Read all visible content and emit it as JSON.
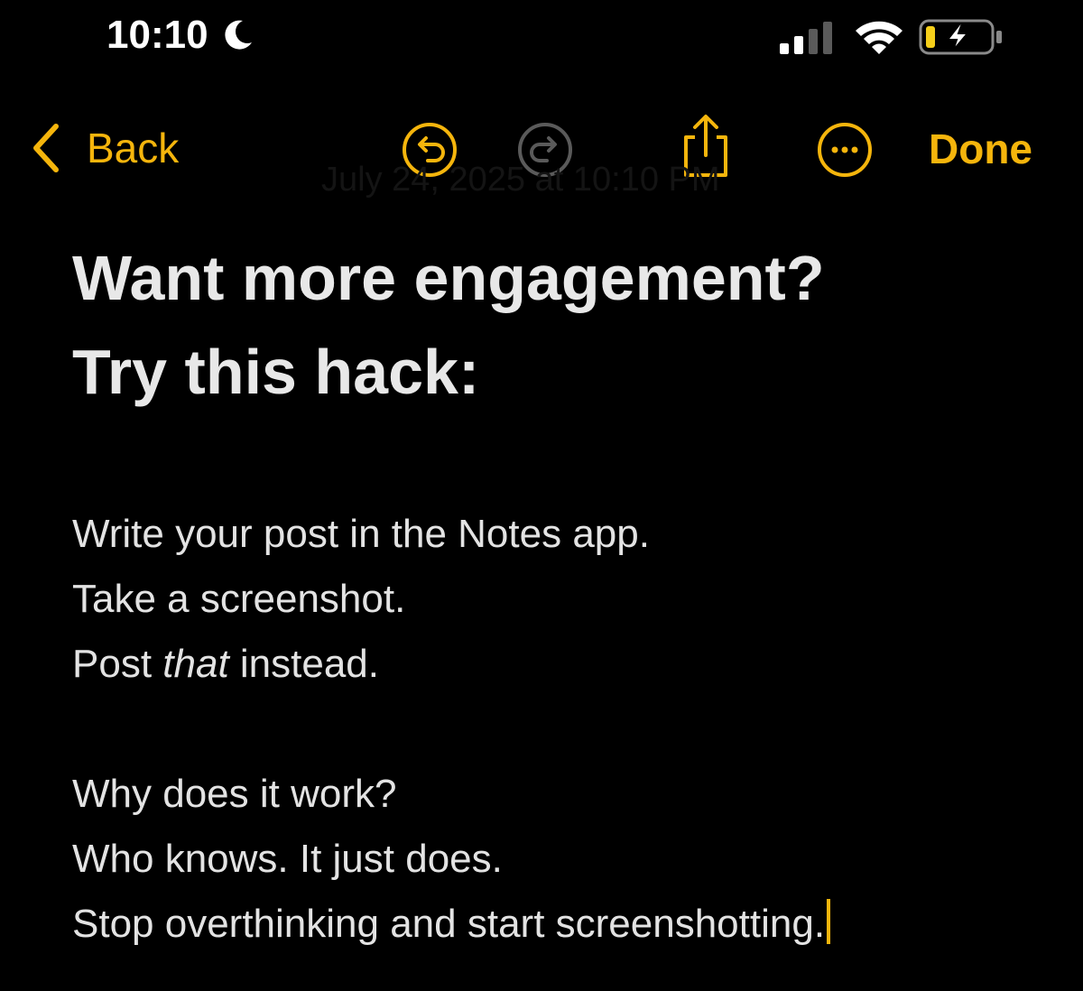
{
  "status_bar": {
    "time": "10:10",
    "icons": [
      "moon-icon",
      "cellular-signal-icon",
      "wifi-icon",
      "battery-charging-icon"
    ]
  },
  "toolbar": {
    "back_label": "Back",
    "done_label": "Done",
    "icons": [
      "chevron-left-icon",
      "undo-icon",
      "redo-icon",
      "share-icon",
      "more-icon"
    ],
    "date_text": "July 24, 2025 at 10:10 PM"
  },
  "note": {
    "title_line_1": "Want more engagement?",
    "title_line_2": "Try this hack:",
    "body": {
      "line_1": "Write your post in the Notes app.",
      "line_2": "Take a screenshot.",
      "line_3_start": "Post ",
      "line_3_italic": "that",
      "line_3_end": " instead.",
      "line_4": "Why does it work?",
      "line_5": "Who knows. It just does.",
      "line_6": "Stop overthinking and start screenshotting."
    }
  },
  "colors": {
    "background": "#000000",
    "accent": "#f5b50c",
    "text": "#e6e6e6",
    "disabled": "#5a5a5a"
  }
}
